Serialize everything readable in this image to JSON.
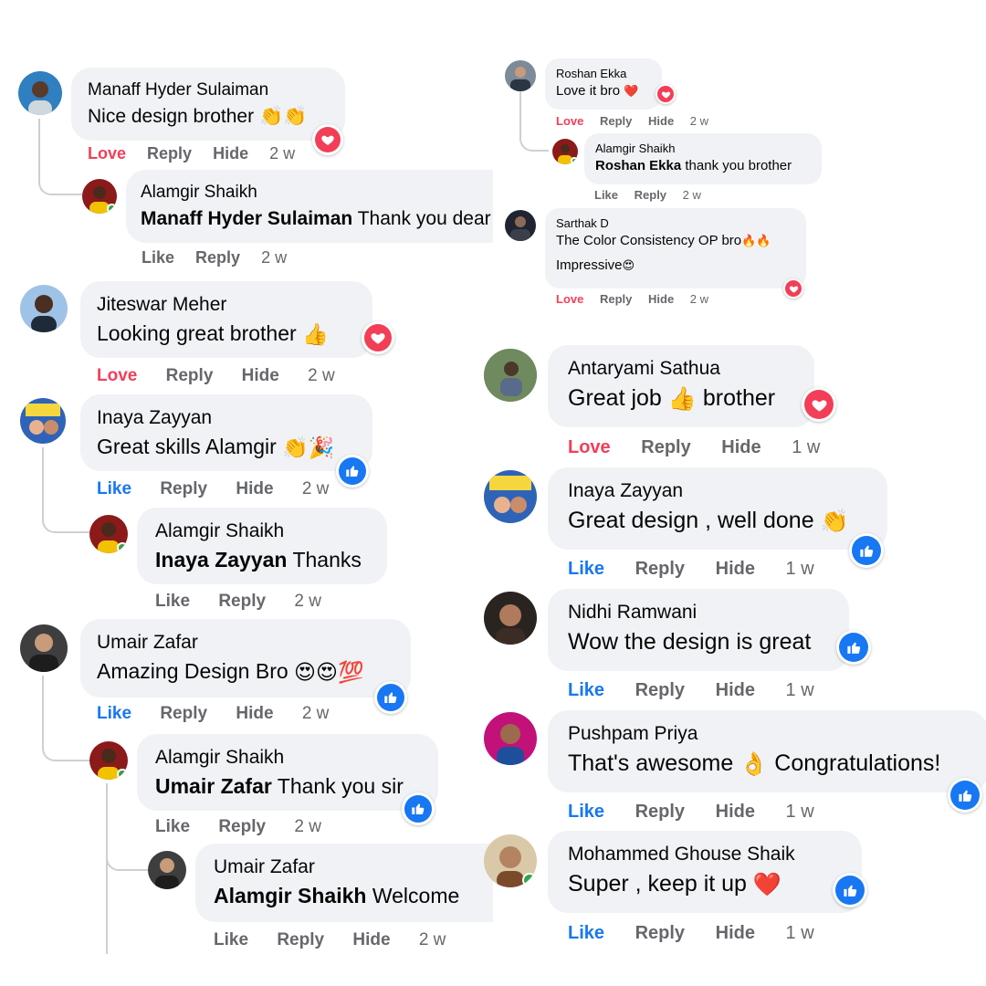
{
  "colors": {
    "bubble": "#f0f2f5",
    "love": "#f33e58",
    "like": "#1877f2",
    "meta": "#65676b",
    "line": "#ccd0d5",
    "online": "#31a24c"
  },
  "icons": {
    "heart": "heart-reaction-icon",
    "thumb": "like-reaction-icon"
  },
  "left": [
    {
      "name": "Manaff Hyder Sulaiman",
      "text": "Nice design brother",
      "emoji": "👏👏",
      "react_label": "Love",
      "reply": "Reply",
      "hide": "Hide",
      "time": "2 w",
      "reaction": "heart"
    },
    {
      "name": "Alamgir Shaikh",
      "mention": "Manaff Hyder Sulaiman",
      "text": " Thank you dear",
      "react_label": "Like",
      "reply": "Reply",
      "time": "2 w"
    },
    {
      "name": "Jiteswar Meher",
      "text": "Looking great brother",
      "emoji": "👍",
      "react_label": "Love",
      "reply": "Reply",
      "hide": "Hide",
      "time": "2 w",
      "reaction": "heart"
    },
    {
      "name": "Inaya Zayyan",
      "text": "Great skills Alamgir",
      "emoji": "👏🎉",
      "react_label": "Like",
      "reply": "Reply",
      "hide": "Hide",
      "time": "2 w",
      "reaction": "thumb"
    },
    {
      "name": "Alamgir Shaikh",
      "mention": "Inaya Zayyan",
      "text": " Thanks",
      "react_label": "Like",
      "reply": "Reply",
      "time": "2 w"
    },
    {
      "name": "Umair Zafar",
      "text": "Amazing Design Bro",
      "emoji": "😍😍💯",
      "react_label": "Like",
      "reply": "Reply",
      "hide": "Hide",
      "time": "2 w",
      "reaction": "thumb"
    },
    {
      "name": "Alamgir Shaikh",
      "mention": "Umair Zafar",
      "text": " Thank you sir",
      "react_label": "Like",
      "reply": "Reply",
      "time": "2 w",
      "reaction": "thumb"
    },
    {
      "name": "Umair Zafar",
      "mention": "Alamgir Shaikh",
      "text": " Welcome",
      "react_label": "Like",
      "reply": "Reply",
      "hide": "Hide",
      "time": "2 w"
    }
  ],
  "right_top": [
    {
      "name": "Roshan Ekka",
      "text": "Love it bro",
      "emoji": "❤️",
      "react_label": "Love",
      "reply": "Reply",
      "hide": "Hide",
      "time": "2 w",
      "reaction": "heart"
    },
    {
      "name": "Alamgir Shaikh",
      "mention": "Roshan Ekka",
      "text": " thank you brother",
      "react_label": "Like",
      "reply": "Reply",
      "time": "2 w"
    },
    {
      "name": "Sarthak D",
      "text": "The Color Consistency OP bro",
      "emoji": "🔥🔥",
      "text2": "Impressive",
      "emoji2": "😍",
      "react_label": "Love",
      "reply": "Reply",
      "hide": "Hide",
      "time": "2 w",
      "reaction": "heart"
    }
  ],
  "right": [
    {
      "name": "Antaryami Sathua",
      "text": "Great job",
      "emoji": "👍",
      "text_after": " brother",
      "react_label": "Love",
      "reply": "Reply",
      "hide": "Hide",
      "time": "1 w",
      "reaction": "heart"
    },
    {
      "name": "Inaya Zayyan",
      "text": "Great design , well done",
      "emoji": "👏",
      "react_label": "Like",
      "reply": "Reply",
      "hide": "Hide",
      "time": "1 w",
      "reaction": "thumb"
    },
    {
      "name": "Nidhi Ramwani",
      "text": "Wow the design is great",
      "react_label": "Like",
      "reply": "Reply",
      "hide": "Hide",
      "time": "1 w",
      "reaction": "thumb"
    },
    {
      "name": "Pushpam Priya",
      "text": "That's awesome",
      "emoji": "👌",
      "text_after": " Congratulations!",
      "react_label": "Like",
      "reply": "Reply",
      "hide": "Hide",
      "time": "1 w",
      "reaction": "thumb"
    },
    {
      "name": "Mohammed Ghouse Shaik",
      "text": "Super , keep it up",
      "emoji": "❤️",
      "react_label": "Like",
      "reply": "Reply",
      "hide": "Hide",
      "time": "1 w",
      "reaction": "thumb"
    }
  ]
}
